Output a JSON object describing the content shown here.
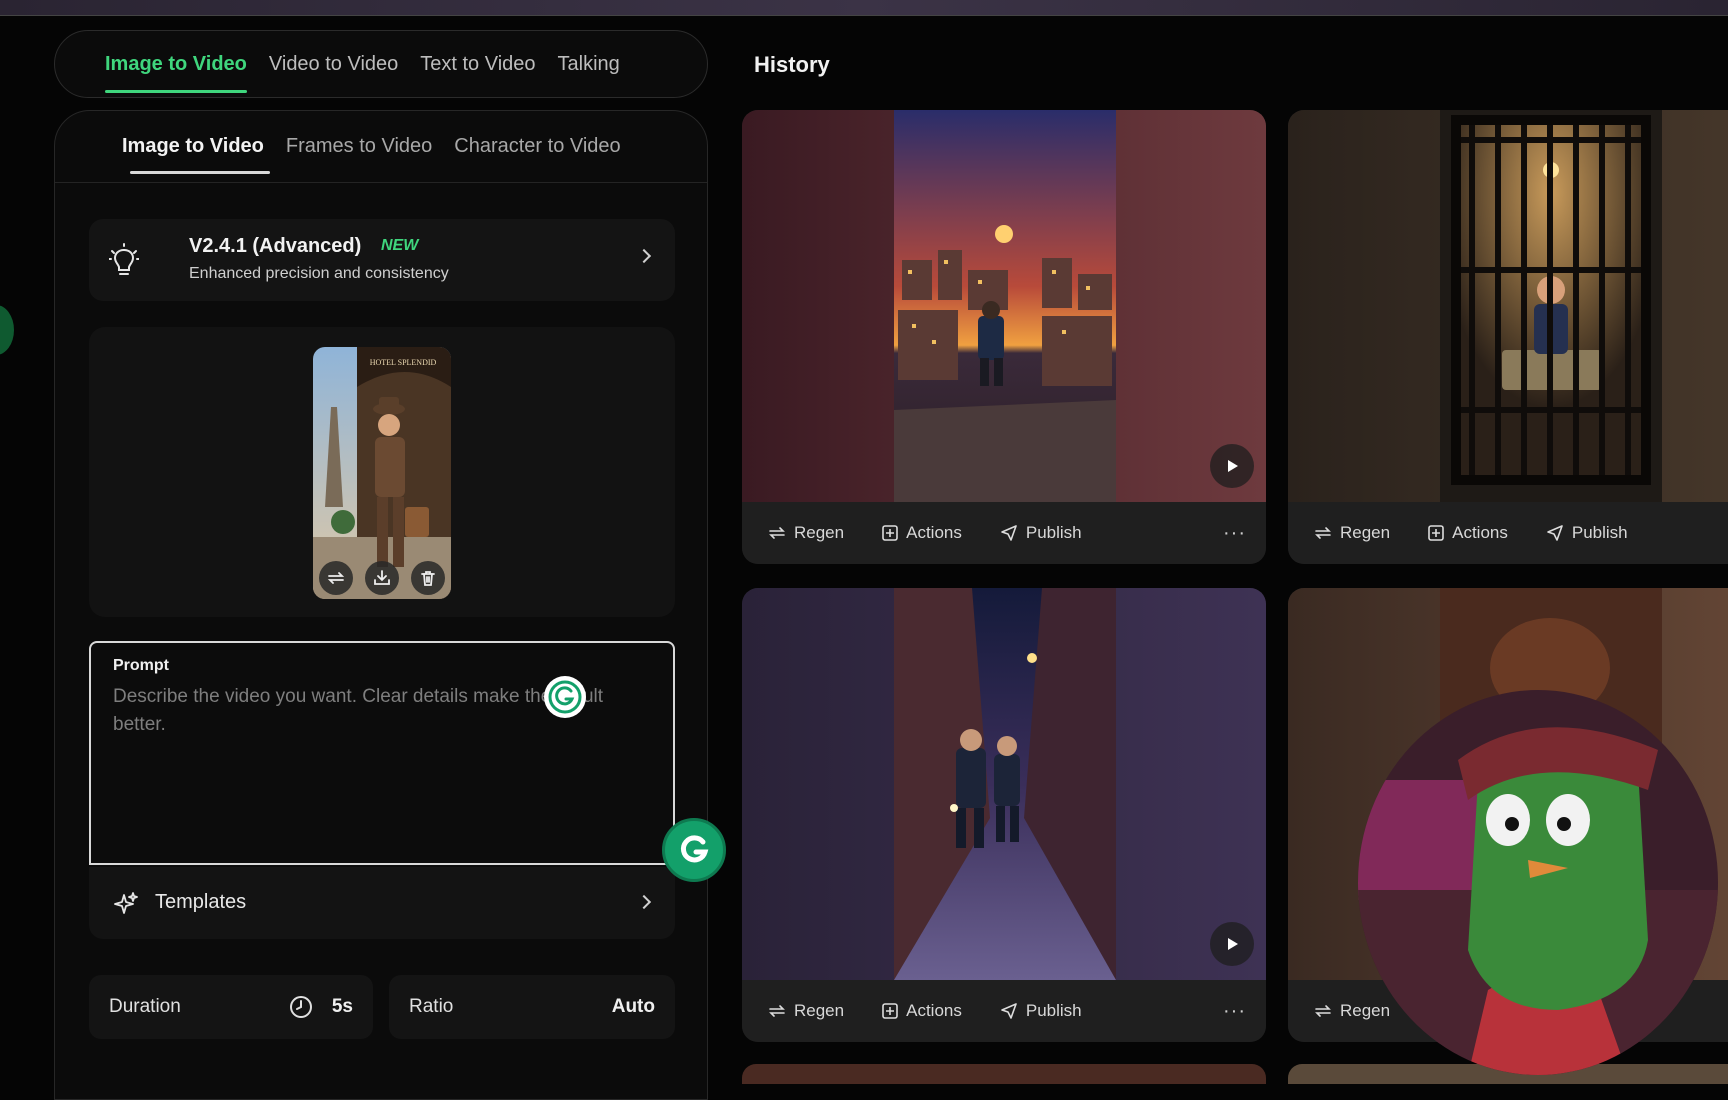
{
  "main_tabs": [
    {
      "label": "Image to Video",
      "active": true
    },
    {
      "label": "Video to Video",
      "active": false
    },
    {
      "label": "Text to Video",
      "active": false
    },
    {
      "label": "Talking",
      "active": false
    }
  ],
  "sub_tabs": [
    {
      "label": "Image to Video",
      "active": true
    },
    {
      "label": "Frames to Video",
      "active": false
    },
    {
      "label": "Character to Video",
      "active": false
    }
  ],
  "model": {
    "name": "V2.4.1 (Advanced)",
    "badge": "NEW",
    "description": "Enhanced precision and consistency",
    "icon": "lightbulb-icon"
  },
  "upload": {
    "thumbnail_sign": "HOTEL SPLENDID",
    "actions": [
      "replace-icon",
      "download-icon",
      "delete-icon"
    ]
  },
  "prompt": {
    "label": "Prompt",
    "placeholder": "Describe the video you want. Clear details make the result better.",
    "value": ""
  },
  "templates": {
    "label": "Templates",
    "icon": "sparkle-icon"
  },
  "duration": {
    "label": "Duration",
    "value": "5s",
    "icon": "clock-icon"
  },
  "ratio": {
    "label": "Ratio",
    "value": "Auto"
  },
  "history": {
    "title": "History",
    "actions": {
      "regen": "Regen",
      "actions": "Actions",
      "publish": "Publish",
      "more": "···"
    }
  },
  "colors": {
    "accent": "#3fd67d",
    "background": "#050505",
    "panel": "#0b0b0b",
    "card_bar": "#1f1f1f"
  }
}
